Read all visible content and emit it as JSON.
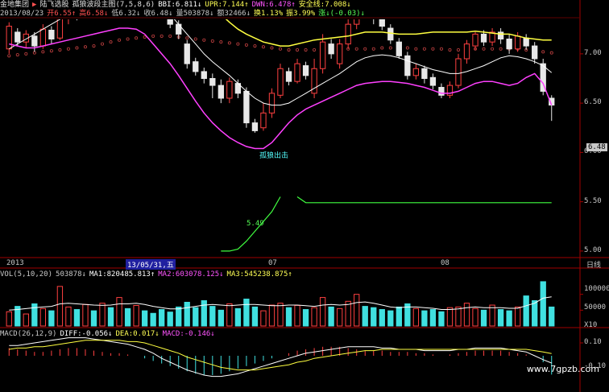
{
  "header": {
    "row1": [
      "金地集团",
      "▶",
      "陆飞选股",
      "孤狼波段主图(7,5,8,6)",
      "BBI:6.811↓",
      "UPR:7.144↑",
      "DWN:6.478↑",
      "安全线:7.008↓"
    ],
    "row1_colors": [
      "#e0e0e0",
      "#ff5050",
      "#e0e0e0",
      "#e0e0e0",
      "#ffffff",
      "#ffff55",
      "#ff55ff",
      "#ffff55"
    ],
    "row2": [
      "2013/08/23",
      "开6.55↑",
      "高6.58↓",
      "低6.32↓",
      "收6.48↓",
      "量503878↓",
      "额32466↓",
      "换1.13%",
      "振3.99%",
      "涨↓(-0.03)↓"
    ],
    "row2_colors": [
      "#c8c8c8",
      "#ff5050",
      "#ff5050",
      "#c8c8c8",
      "#c8c8c8",
      "#c8c8c8",
      "#c8c8c8",
      "#ffff55",
      "#ffff55",
      "#55ff55"
    ]
  },
  "axis": {
    "price_ticks": [
      "7.00",
      "6.50",
      "6.00",
      "5.50",
      "5.00"
    ],
    "current_price": "6.48",
    "x_labels": [
      "2013",
      "13/05/31,五",
      "07",
      "08"
    ],
    "period_label": "日线"
  },
  "annotations": {
    "signal": "孤狼出击",
    "green_low": "5.49"
  },
  "vol_panel": {
    "header": [
      "VOL(5,10,20)",
      "503878↓",
      "MA1:820485.813↑",
      "MA2:603078.125↓",
      "MA3:545238.875↑"
    ],
    "header_colors": [
      "#c8c8c8",
      "#c8c8c8",
      "#ffffff",
      "#ff55ff",
      "#ffff55"
    ],
    "ticks": [
      "100000",
      "50000"
    ],
    "unit": "X10"
  },
  "macd_panel": {
    "header": [
      "MACD(26,12,9)",
      "DIFF:-0.056↓",
      "DEA:0.017↓",
      "MACD:-0.146↓"
    ],
    "header_colors": [
      "#c8c8c8",
      "#ffffff",
      "#ffff55",
      "#ff55ff"
    ],
    "ticks": [
      "0.10",
      "-0.10"
    ]
  },
  "watermark": "www.7gpzb.com",
  "chart_data": {
    "type": "candlestick",
    "ylim": [
      4.95,
      7.35
    ],
    "candles": [
      {
        "o": 7.05,
        "c": 7.28,
        "h": 7.32,
        "l": 7.0
      },
      {
        "o": 7.22,
        "c": 7.12,
        "h": 7.26,
        "l": 7.08
      },
      {
        "o": 7.12,
        "c": 7.2,
        "h": 7.24,
        "l": 7.06
      },
      {
        "o": 7.18,
        "c": 7.08,
        "h": 7.22,
        "l": 7.02
      },
      {
        "o": 7.08,
        "c": 7.25,
        "h": 7.3,
        "l": 7.05
      },
      {
        "o": 7.24,
        "c": 7.15,
        "h": 7.28,
        "l": 7.1
      },
      {
        "o": 7.16,
        "c": 7.4,
        "h": 7.45,
        "l": 7.14
      },
      {
        "o": 7.38,
        "c": 7.5,
        "h": 7.55,
        "l": 7.3
      },
      {
        "o": 7.48,
        "c": 7.38,
        "h": 7.52,
        "l": 7.34
      },
      {
        "o": 7.4,
        "c": 7.55,
        "h": 7.6,
        "l": 7.36
      },
      {
        "o": 7.55,
        "c": 7.45,
        "h": 7.58,
        "l": 7.4
      },
      {
        "o": 7.45,
        "c": 7.62,
        "h": 7.66,
        "l": 7.43
      },
      {
        "o": 7.6,
        "c": 7.5,
        "h": 7.64,
        "l": 7.46
      },
      {
        "o": 7.45,
        "c": 7.72,
        "h": 7.76,
        "l": 7.42
      },
      {
        "o": 7.7,
        "c": 7.6,
        "h": 7.74,
        "l": 7.55
      },
      {
        "o": 7.62,
        "c": 7.7,
        "h": 7.75,
        "l": 7.58
      },
      {
        "o": 7.68,
        "c": 7.56,
        "h": 7.72,
        "l": 7.52
      },
      {
        "o": 7.55,
        "c": 7.48,
        "h": 7.6,
        "l": 7.44
      },
      {
        "o": 7.48,
        "c": 7.4,
        "h": 7.52,
        "l": 7.36
      },
      {
        "o": 7.38,
        "c": 7.3,
        "h": 7.42,
        "l": 7.26
      },
      {
        "o": 7.3,
        "c": 7.2,
        "h": 7.34,
        "l": 7.15
      },
      {
        "o": 7.1,
        "c": 6.9,
        "h": 7.14,
        "l": 6.85
      },
      {
        "o": 6.92,
        "c": 6.82,
        "h": 6.96,
        "l": 6.78
      },
      {
        "o": 6.82,
        "c": 6.75,
        "h": 6.86,
        "l": 6.7
      },
      {
        "o": 6.75,
        "c": 6.68,
        "h": 6.8,
        "l": 6.55
      },
      {
        "o": 6.68,
        "c": 6.55,
        "h": 6.74,
        "l": 6.5
      },
      {
        "o": 6.55,
        "c": 6.72,
        "h": 6.76,
        "l": 6.5
      },
      {
        "o": 6.7,
        "c": 6.6,
        "h": 6.74,
        "l": 6.55
      },
      {
        "o": 6.62,
        "c": 6.3,
        "h": 6.66,
        "l": 6.25
      },
      {
        "o": 6.3,
        "c": 6.22,
        "h": 6.34,
        "l": 6.2
      },
      {
        "o": 6.25,
        "c": 6.4,
        "h": 6.5,
        "l": 6.22
      },
      {
        "o": 6.4,
        "c": 6.6,
        "h": 6.65,
        "l": 6.35
      },
      {
        "o": 6.58,
        "c": 6.85,
        "h": 6.9,
        "l": 6.55
      },
      {
        "o": 6.82,
        "c": 6.72,
        "h": 6.86,
        "l": 6.68
      },
      {
        "o": 6.72,
        "c": 6.9,
        "h": 6.95,
        "l": 6.7
      },
      {
        "o": 6.88,
        "c": 6.78,
        "h": 6.92,
        "l": 6.74
      },
      {
        "o": 6.6,
        "c": 6.85,
        "h": 6.95,
        "l": 6.55
      },
      {
        "o": 6.85,
        "c": 7.12,
        "h": 7.2,
        "l": 6.8
      },
      {
        "o": 7.1,
        "c": 7.0,
        "h": 7.15,
        "l": 6.95
      },
      {
        "o": 6.9,
        "c": 7.1,
        "h": 7.15,
        "l": 6.85
      },
      {
        "o": 7.1,
        "c": 7.3,
        "h": 7.4,
        "l": 7.05
      },
      {
        "o": 7.3,
        "c": 7.58,
        "h": 7.64,
        "l": 7.25
      },
      {
        "o": 7.58,
        "c": 7.48,
        "h": 7.62,
        "l": 7.42
      },
      {
        "o": 7.46,
        "c": 7.36,
        "h": 7.5,
        "l": 7.3
      },
      {
        "o": 7.36,
        "c": 7.28,
        "h": 7.4,
        "l": 7.24
      },
      {
        "o": 7.26,
        "c": 7.14,
        "h": 7.3,
        "l": 7.1
      },
      {
        "o": 7.12,
        "c": 6.98,
        "h": 7.16,
        "l": 6.95
      },
      {
        "o": 6.98,
        "c": 6.78,
        "h": 7.02,
        "l": 6.74
      },
      {
        "o": 6.78,
        "c": 6.85,
        "h": 6.9,
        "l": 6.74
      },
      {
        "o": 6.85,
        "c": 6.75,
        "h": 6.88,
        "l": 6.7
      },
      {
        "o": 6.76,
        "c": 6.68,
        "h": 6.8,
        "l": 6.64
      },
      {
        "o": 6.66,
        "c": 6.58,
        "h": 6.7,
        "l": 6.55
      },
      {
        "o": 6.58,
        "c": 6.68,
        "h": 6.72,
        "l": 6.55
      },
      {
        "o": 6.68,
        "c": 6.95,
        "h": 7.0,
        "l": 6.65
      },
      {
        "o": 6.95,
        "c": 7.1,
        "h": 7.14,
        "l": 6.9
      },
      {
        "o": 7.08,
        "c": 7.2,
        "h": 7.22,
        "l": 7.04
      },
      {
        "o": 7.2,
        "c": 7.12,
        "h": 7.24,
        "l": 7.08
      },
      {
        "o": 7.12,
        "c": 7.22,
        "h": 7.26,
        "l": 7.08
      },
      {
        "o": 7.22,
        "c": 7.15,
        "h": 7.26,
        "l": 7.1
      },
      {
        "o": 7.15,
        "c": 7.05,
        "h": 7.2,
        "l": 7.0
      },
      {
        "o": 7.05,
        "c": 7.18,
        "h": 7.22,
        "l": 7.02
      },
      {
        "o": 7.16,
        "c": 7.08,
        "h": 7.2,
        "l": 7.04
      },
      {
        "o": 7.08,
        "c": 6.95,
        "h": 7.12,
        "l": 6.9
      },
      {
        "o": 6.9,
        "c": 6.62,
        "h": 6.95,
        "l": 6.58
      },
      {
        "o": 6.55,
        "c": 6.48,
        "h": 6.58,
        "l": 6.32
      }
    ],
    "upr": [
      7.8,
      7.95,
      8.1,
      8.2,
      8.35,
      8.45,
      8.5,
      8.58,
      8.62,
      8.65,
      8.66,
      8.66,
      8.64,
      8.6,
      8.55,
      8.5,
      8.42,
      8.3,
      8.2,
      8.1,
      7.98,
      7.85,
      7.72,
      7.6,
      7.5,
      7.4,
      7.32,
      7.25,
      7.2,
      7.16,
      7.12,
      7.1,
      7.08,
      7.08,
      7.1,
      7.12,
      7.14,
      7.15,
      7.16,
      7.17,
      7.18,
      7.2,
      7.22,
      7.22,
      7.22,
      7.21,
      7.2,
      7.2,
      7.2,
      7.21,
      7.22,
      7.22,
      7.22,
      7.22,
      7.22,
      7.23,
      7.22,
      7.21,
      7.2,
      7.2,
      7.18,
      7.16,
      7.15,
      7.14,
      7.14
    ],
    "bbi": [
      7.05,
      7.1,
      7.15,
      7.2,
      7.25,
      7.3,
      7.35,
      7.4,
      7.45,
      7.5,
      7.52,
      7.55,
      7.57,
      7.58,
      7.58,
      7.57,
      7.55,
      7.5,
      7.45,
      7.4,
      7.3,
      7.2,
      7.1,
      7.0,
      6.92,
      6.85,
      6.78,
      6.7,
      6.62,
      6.55,
      6.5,
      6.48,
      6.48,
      6.5,
      6.55,
      6.6,
      6.65,
      6.7,
      6.75,
      6.8,
      6.86,
      6.92,
      6.96,
      6.98,
      6.99,
      6.98,
      6.96,
      6.93,
      6.9,
      6.87,
      6.84,
      6.82,
      6.8,
      6.8,
      6.82,
      6.85,
      6.88,
      6.92,
      6.96,
      6.98,
      6.97,
      6.95,
      6.92,
      6.88,
      6.81
    ],
    "dwn": [
      7.1,
      7.08,
      7.06,
      7.06,
      7.08,
      7.1,
      7.12,
      7.14,
      7.16,
      7.18,
      7.2,
      7.22,
      7.24,
      7.26,
      7.26,
      7.25,
      7.2,
      7.1,
      7.0,
      6.9,
      6.78,
      6.65,
      6.52,
      6.4,
      6.3,
      6.22,
      6.15,
      6.1,
      6.06,
      6.04,
      6.04,
      6.1,
      6.2,
      6.3,
      6.38,
      6.44,
      6.48,
      6.52,
      6.56,
      6.6,
      6.64,
      6.68,
      6.7,
      6.71,
      6.72,
      6.72,
      6.71,
      6.7,
      6.68,
      6.66,
      6.63,
      6.6,
      6.6,
      6.62,
      6.66,
      6.7,
      6.72,
      6.72,
      6.7,
      6.68,
      6.7,
      6.76,
      6.8,
      6.7,
      6.48
    ],
    "safe": [
      6.98,
      6.99,
      7.0,
      7.01,
      7.02,
      7.03,
      7.04,
      7.05,
      7.06,
      7.07,
      7.08,
      7.1,
      7.12,
      7.14,
      7.15,
      7.16,
      7.17,
      7.18,
      7.18,
      7.18,
      7.17,
      7.16,
      7.15,
      7.14,
      7.13,
      7.12,
      7.11,
      7.1,
      7.09,
      7.08,
      7.07,
      7.06,
      7.05,
      7.04,
      7.04,
      7.04,
      7.04,
      7.04,
      7.04,
      7.05,
      7.05,
      7.05,
      7.05,
      7.05,
      7.06,
      7.06,
      7.06,
      7.06,
      7.05,
      7.05,
      7.05,
      7.05,
      7.04,
      7.04,
      7.04,
      7.05,
      7.05,
      7.05,
      7.05,
      7.05,
      7.05,
      7.04,
      7.04,
      7.02,
      7.01
    ],
    "green": [
      7.72,
      7.72,
      7.72,
      7.7,
      7.68,
      7.66,
      7.62,
      7.55,
      7.5,
      7.5,
      7.5,
      7.5,
      7.5,
      7.5,
      7.5,
      7.5,
      7.5,
      7.5,
      7.5,
      7.5,
      7.5,
      7.5,
      7.5,
      7.5,
      7.5,
      7.5,
      7.5,
      7.5,
      7.5,
      7.5,
      7.5,
      7.5,
      7.5,
      7.5,
      7.5,
      7.5,
      7.5,
      7.5,
      7.5,
      7.5,
      7.5,
      7.5,
      7.5,
      7.5,
      7.5,
      7.5,
      7.5,
      7.5,
      7.5,
      7.5,
      7.5,
      7.5,
      7.5,
      7.5,
      7.5,
      7.5,
      7.5,
      7.5,
      7.5,
      7.5,
      7.5,
      7.5,
      7.5,
      7.5,
      7.5
    ],
    "green2": [
      null,
      null,
      null,
      null,
      null,
      null,
      null,
      null,
      null,
      null,
      null,
      null,
      null,
      null,
      null,
      null,
      null,
      null,
      null,
      null,
      null,
      null,
      null,
      null,
      null,
      5.0,
      5.0,
      5.02,
      5.1,
      5.2,
      5.3,
      5.4,
      5.55,
      null,
      5.55,
      5.49,
      5.49,
      5.49,
      5.49,
      5.49,
      5.49,
      5.49,
      5.49,
      5.49,
      5.49,
      5.49,
      5.49,
      5.49,
      5.49,
      5.49,
      5.49,
      5.49,
      5.49,
      5.49,
      5.49,
      5.49,
      5.49,
      5.49,
      5.49,
      5.49,
      5.49,
      5.49,
      5.49,
      5.49,
      5.49
    ],
    "volume": [
      45,
      62,
      38,
      70,
      55,
      48,
      125,
      60,
      52,
      68,
      48,
      72,
      58,
      90,
      55,
      65,
      48,
      40,
      52,
      44,
      60,
      75,
      58,
      80,
      62,
      50,
      70,
      55,
      85,
      60,
      48,
      66,
      72,
      58,
      65,
      52,
      58,
      90,
      60,
      55,
      78,
      100,
      62,
      58,
      52,
      48,
      60,
      70,
      55,
      48,
      52,
      45,
      58,
      60,
      72,
      55,
      50,
      66,
      52,
      48,
      60,
      95,
      80,
      140,
      60
    ],
    "vol_ma1": [
      50,
      52,
      55,
      58,
      60,
      62,
      70,
      72,
      70,
      68,
      66,
      65,
      66,
      70,
      70,
      72,
      68,
      62,
      58,
      54,
      54,
      58,
      62,
      66,
      68,
      66,
      64,
      66,
      68,
      68,
      66,
      64,
      64,
      66,
      66,
      64,
      62,
      66,
      68,
      66,
      68,
      74,
      76,
      72,
      66,
      60,
      58,
      60,
      60,
      58,
      56,
      52,
      52,
      54,
      58,
      60,
      58,
      58,
      58,
      56,
      56,
      64,
      72,
      88,
      92
    ],
    "macd_bar": [
      0.06,
      0.05,
      0.04,
      0.03,
      0.03,
      0.04,
      0.05,
      0.06,
      0.06,
      0.05,
      0.04,
      0.03,
      0.02,
      0.02,
      0.01,
      0.0,
      -0.02,
      -0.04,
      -0.06,
      -0.08,
      -0.1,
      -0.12,
      -0.14,
      -0.15,
      -0.15,
      -0.14,
      -0.12,
      -0.1,
      -0.08,
      -0.06,
      -0.04,
      -0.02,
      0.0,
      0.02,
      0.04,
      0.05,
      0.06,
      0.07,
      0.07,
      0.07,
      0.06,
      0.05,
      0.04,
      0.04,
      0.04,
      0.03,
      0.03,
      0.03,
      0.02,
      0.02,
      0.01,
      0.0,
      0.01,
      0.02,
      0.03,
      0.04,
      0.04,
      0.04,
      0.04,
      0.03,
      0.02,
      0.01,
      0.0,
      -0.05,
      -0.146
    ],
    "diff": [
      0.08,
      0.08,
      0.09,
      0.1,
      0.11,
      0.12,
      0.13,
      0.14,
      0.14,
      0.14,
      0.13,
      0.12,
      0.11,
      0.1,
      0.09,
      0.07,
      0.05,
      0.02,
      -0.02,
      -0.05,
      -0.08,
      -0.11,
      -0.13,
      -0.15,
      -0.16,
      -0.16,
      -0.15,
      -0.14,
      -0.12,
      -0.1,
      -0.08,
      -0.06,
      -0.04,
      -0.02,
      0.0,
      0.02,
      0.03,
      0.04,
      0.05,
      0.06,
      0.07,
      0.07,
      0.07,
      0.07,
      0.06,
      0.06,
      0.05,
      0.05,
      0.05,
      0.04,
      0.04,
      0.04,
      0.04,
      0.05,
      0.05,
      0.06,
      0.06,
      0.06,
      0.06,
      0.05,
      0.04,
      0.03,
      0.0,
      -0.03,
      -0.056
    ],
    "dea": [
      0.05,
      0.06,
      0.06,
      0.07,
      0.07,
      0.08,
      0.09,
      0.1,
      0.11,
      0.12,
      0.12,
      0.12,
      0.12,
      0.12,
      0.11,
      0.11,
      0.1,
      0.08,
      0.06,
      0.04,
      0.02,
      -0.01,
      -0.03,
      -0.05,
      -0.07,
      -0.09,
      -0.1,
      -0.11,
      -0.11,
      -0.11,
      -0.1,
      -0.09,
      -0.08,
      -0.07,
      -0.05,
      -0.04,
      -0.02,
      -0.01,
      0.0,
      0.01,
      0.02,
      0.03,
      0.04,
      0.04,
      0.05,
      0.05,
      0.05,
      0.05,
      0.05,
      0.05,
      0.05,
      0.05,
      0.05,
      0.05,
      0.05,
      0.05,
      0.05,
      0.05,
      0.05,
      0.05,
      0.05,
      0.05,
      0.04,
      0.03,
      0.017
    ]
  }
}
